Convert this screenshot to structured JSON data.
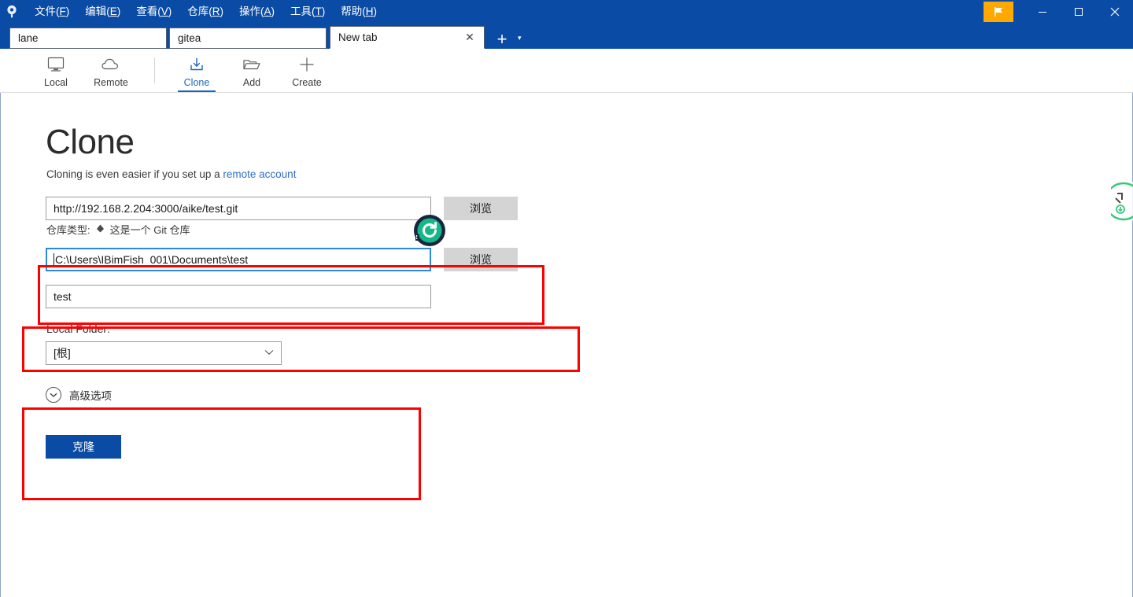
{
  "window": {
    "app_logo_icon": "sourcetree-pin-icon",
    "accent_blue": "#0a4ba5",
    "flag_button_color": "#ffa800",
    "flag_icon": "flag-icon",
    "minimize_icon": "minimize-icon",
    "maximize_icon": "maximize-icon",
    "close_icon": "close-icon"
  },
  "menubar": {
    "items": [
      {
        "text": "文件",
        "acc": "F"
      },
      {
        "text": "编辑",
        "acc": "E"
      },
      {
        "text": "查看",
        "acc": "V"
      },
      {
        "text": "仓库",
        "acc": "R"
      },
      {
        "text": "操作",
        "acc": "A"
      },
      {
        "text": "工具",
        "acc": "T"
      },
      {
        "text": "帮助",
        "acc": "H"
      }
    ]
  },
  "tabs": {
    "items": [
      {
        "label": "lane",
        "active": false
      },
      {
        "label": "gitea",
        "active": false
      },
      {
        "label": "New tab",
        "active": true
      }
    ],
    "close_glyph": "✕",
    "add_glyph": "+",
    "add_menu_glyph": "▾"
  },
  "toolbar": {
    "items": [
      {
        "label": "Local",
        "icon": "monitor-icon",
        "active": false
      },
      {
        "label": "Remote",
        "icon": "cloud-icon",
        "active": false
      },
      {
        "label": "Clone",
        "icon": "download-icon",
        "active": true
      },
      {
        "label": "Add",
        "icon": "folder-icon",
        "active": false
      },
      {
        "label": "Create",
        "icon": "plus-icon",
        "active": false
      }
    ],
    "active_color": "#1566c0"
  },
  "page": {
    "title": "Clone",
    "hint_prefix": "Cloning is even easier if you set up a ",
    "hint_link": "remote account",
    "source_url": {
      "value": "http://192.168.2.204:3000/aike/test.git",
      "browse_label": "浏览"
    },
    "repo_type_label": "仓库类型:",
    "repo_type_value": "这是一个 Git 仓库",
    "repo_type_icon": "git-repo-icon",
    "destination_path": {
      "value": "C:\\Users\\IBimFish_001\\Documents\\test",
      "browse_label": "浏览",
      "focused": true
    },
    "repo_name": {
      "value": "test"
    },
    "local_folder": {
      "label": "Local Folder:",
      "value": "[根]",
      "chevron_icon": "chevron-down-icon"
    },
    "advanced_options": {
      "label": "高级选项",
      "icon": "chevron-down-circle-icon"
    },
    "clone_button_label": "克隆",
    "clone_button_color": "#0a4ba5"
  },
  "annotations": {
    "box_color": "#ff0000",
    "count": 3
  },
  "overlays": {
    "cursor_badge_icon": "green-refresh-badge-icon",
    "edge_badge_icon": "green-download-badge-icon",
    "badge_green": "#12b886",
    "badge_navy": "#1b2540"
  }
}
